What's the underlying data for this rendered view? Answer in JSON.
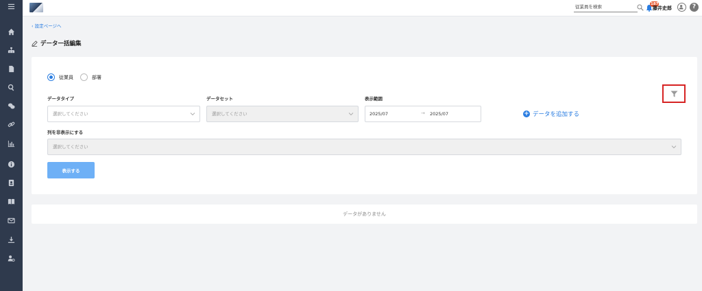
{
  "header": {
    "search_placeholder": "従業員を検索",
    "notification_count": "187",
    "user_name": "藤井史郎",
    "help_label": "?"
  },
  "nav": {
    "back_label": "設定ページへ",
    "page_title": "データ一括編集"
  },
  "sidebar": {
    "items": [
      "menu-icon",
      "home-icon",
      "org-chart-icon",
      "document-icon",
      "search-icon",
      "chat-icon",
      "link-icon",
      "chart-icon",
      "info-icon",
      "contacts-icon",
      "book-icon",
      "mail-icon",
      "download-icon",
      "user-settings-icon"
    ]
  },
  "form": {
    "radio_employee": "従業員",
    "radio_department": "部署",
    "selected_radio": "employee",
    "data_type_label": "データタイプ",
    "data_type_placeholder": "選択してください",
    "data_set_label": "データセット",
    "data_set_placeholder": "選択してください",
    "range_label": "表示範囲",
    "range_start": "2025/07",
    "range_arrow": "→",
    "range_end": "2025/07",
    "add_data_label": "データを追加する",
    "hide_columns_label": "列を非表示にする",
    "hide_columns_placeholder": "選択してください",
    "show_button": "表示する"
  },
  "results": {
    "empty_text": "データがありません"
  },
  "colors": {
    "sidebar": "#2f3a4d",
    "accent": "#2a7de1",
    "button": "#6eb0f6",
    "highlight": "#d62222",
    "badge": "#e8572e"
  }
}
